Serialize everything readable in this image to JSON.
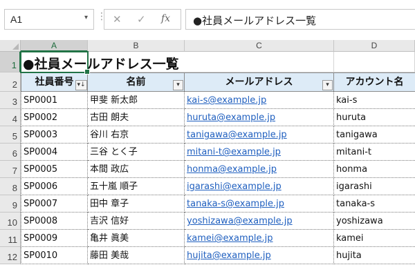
{
  "formula_bar": {
    "name_box": "A1",
    "name_box_arrow": "▾",
    "cancel_glyph": "✕",
    "enter_glyph": "✓",
    "fx_label": "fx",
    "formula": "●社員メールアドレス一覧"
  },
  "columns": [
    "A",
    "B",
    "C",
    "D"
  ],
  "rows": [
    "1",
    "2",
    "3",
    "4",
    "5",
    "6",
    "7",
    "8",
    "9",
    "10",
    "11",
    "12"
  ],
  "sheet": {
    "title": "●社員メールアドレス一覧",
    "headers": [
      "社員番号",
      "名前",
      "メールアドレス",
      "アカウント名"
    ],
    "filter_glyph_sorted": "▾↓",
    "filter_glyph": "▾",
    "records": [
      {
        "id": "SP0001",
        "name": "甲斐 新太郎",
        "email": "kai-s@example.jp",
        "account": "kai-s"
      },
      {
        "id": "SP0002",
        "name": "古田 朗夫",
        "email": "huruta@example.jp",
        "account": "huruta"
      },
      {
        "id": "SP0003",
        "name": "谷川 右京",
        "email": "tanigawa@example.jp",
        "account": "tanigawa"
      },
      {
        "id": "SP0004",
        "name": "三谷 とく子",
        "email": "mitani-t@example.jp",
        "account": "mitani-t"
      },
      {
        "id": "SP0005",
        "name": "本間 政広",
        "email": "honma@example.jp",
        "account": "honma"
      },
      {
        "id": "SP0006",
        "name": "五十嵐 順子",
        "email": "igarashi@example.jp",
        "account": "igarashi"
      },
      {
        "id": "SP0007",
        "name": "田中 章子",
        "email": "tanaka-s@example.jp",
        "account": "tanaka-s"
      },
      {
        "id": "SP0008",
        "name": "吉沢 信好",
        "email": "yoshizawa@example.jp",
        "account": "yoshizawa"
      },
      {
        "id": "SP0009",
        "name": "亀井 眞美",
        "email": "kamei@example.jp",
        "account": "kamei"
      },
      {
        "id": "SP0010",
        "name": "藤田 美哉",
        "email": "hujita@example.jp",
        "account": "hujita"
      }
    ]
  },
  "colors": {
    "selection": "#217346",
    "header_fill": "#ddebf7",
    "link": "#1f5fbf"
  }
}
